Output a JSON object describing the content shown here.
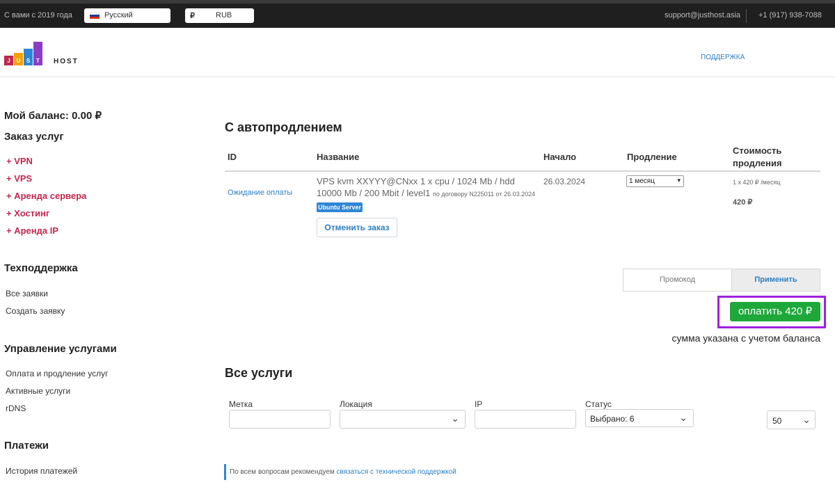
{
  "topbar": {
    "since": "С вами с 2019 года",
    "language": "Русский",
    "currency_symbol": "₽",
    "currency": "RUB",
    "email": "support@justhost.asia",
    "phone": "+1 (917) 938-7088"
  },
  "header": {
    "logo_letters": [
      "J",
      "U",
      "S",
      "T"
    ],
    "logo_word": "HOST",
    "logo_colors": [
      "#c0284f",
      "#f2a10c",
      "#2f86d6",
      "#8b3ec2"
    ],
    "nav_support": "ПОДДЕРЖКА"
  },
  "sidebar": {
    "balance": "Мой баланс: 0.00 ₽",
    "order_heading": "Заказ услуг",
    "order_items": [
      "+ VPN",
      "+ VPS",
      "+ Аренда сервера",
      "+ Хостинг",
      "+ Аренда IP"
    ],
    "support_heading": "Техподдержка",
    "support_items": [
      "Все заявки",
      "Создать заявку"
    ],
    "manage_heading": "Управление услугами",
    "manage_items": [
      "Оплата и продление услуг",
      "Активные услуги",
      "rDNS"
    ],
    "payments_heading": "Платежи",
    "payments_items": [
      "История платежей"
    ]
  },
  "autorenew": {
    "title": "С автопродлением",
    "columns": {
      "id": "ID",
      "name": "Название",
      "start": "Начало",
      "renewal": "Продление",
      "cost_line1": "Стоимость",
      "cost_line2": "продления"
    },
    "row": {
      "status": "Ожидание оплаты",
      "name": "VPS kvm XXYYY@CNxx 1 x cpu / 1024 Mb / hdd 10000 Mb / 200 Mbit / level1",
      "contract": "по договору N225011 от 26.03.2024",
      "badge": "Ubuntu Server",
      "cancel_label": "Отменить заказ",
      "start": "26.03.2024",
      "period": "1 месяц",
      "price_calc": "1 x 420 ₽ /месяц",
      "price_total": "420 ₽"
    }
  },
  "promo": {
    "placeholder": "Промокод",
    "apply_label": "Применить"
  },
  "payment": {
    "pay_label": "оплатить 420 ₽",
    "note": "сумма указана с учетом баланса",
    "highlight_color": "#a11fdd",
    "button_color": "#1fa83a"
  },
  "all_services": {
    "title": "Все услуги",
    "filters": {
      "tag_label": "Метка",
      "location_label": "Локация",
      "ip_label": "IP",
      "status_label": "Статус",
      "status_value": "Выбрано: 6"
    },
    "per_page": "50"
  },
  "help": {
    "text": "По всем вопросам рекомендуем",
    "link": "связаться с технической поддержкой"
  }
}
